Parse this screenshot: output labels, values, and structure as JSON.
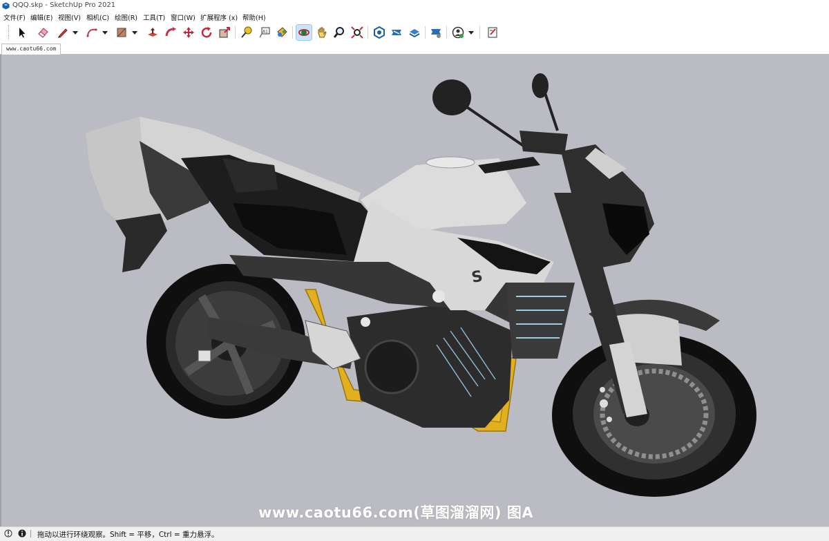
{
  "window": {
    "title": "QQQ.skp - SketchUp Pro 2021"
  },
  "menu": {
    "items": [
      {
        "label": "文件(F)"
      },
      {
        "label": "编辑(E)"
      },
      {
        "label": "视图(V)"
      },
      {
        "label": "相机(C)"
      },
      {
        "label": "绘图(R)"
      },
      {
        "label": "工具(T)"
      },
      {
        "label": "窗口(W)"
      },
      {
        "label": "扩展程序 (x)"
      },
      {
        "label": "帮助(H)"
      }
    ]
  },
  "toolbar": {
    "tools": [
      {
        "icon": "select-arrow-icon"
      },
      {
        "icon": "eraser-icon"
      },
      {
        "icon": "pencil-line-icon"
      },
      {
        "icon": "arc-icon"
      },
      {
        "icon": "rectangle-shape-icon"
      },
      {
        "icon": "push-pull-icon"
      },
      {
        "icon": "follow-me-icon"
      },
      {
        "icon": "move-icon"
      },
      {
        "icon": "rotate-icon"
      },
      {
        "icon": "scale-icon"
      },
      {
        "icon": "tape-measure-icon"
      },
      {
        "icon": "text-label-icon"
      },
      {
        "icon": "paint-bucket-icon"
      },
      {
        "icon": "orbit-icon",
        "active": true
      },
      {
        "icon": "pan-hand-icon"
      },
      {
        "icon": "zoom-icon"
      },
      {
        "icon": "zoom-extents-icon"
      },
      {
        "icon": "3d-warehouse-icon"
      },
      {
        "icon": "extension-warehouse-icon"
      },
      {
        "icon": "layout-send-icon"
      },
      {
        "icon": "extension-manager-icon"
      },
      {
        "icon": "account-user-icon"
      },
      {
        "icon": "model-info-icon"
      }
    ]
  },
  "scene_tabs": [
    {
      "label": "www.caotu66.com"
    }
  ],
  "viewport": {
    "background": "#bbbcc3",
    "model": "motorcycle-model",
    "brand_badge": "S",
    "watermark": "www.caotu66.com(草图溜溜网) 图A"
  },
  "status": {
    "text": "拖动以进行环绕观察。Shift = 平移，Ctrl = 重力悬浮。"
  },
  "colors": {
    "frame_yellow": "#e2b01e",
    "body_silver": "#d9d9d9",
    "dark_parts": "#2f2f2f",
    "toolbar_active": "#cce4f7"
  }
}
